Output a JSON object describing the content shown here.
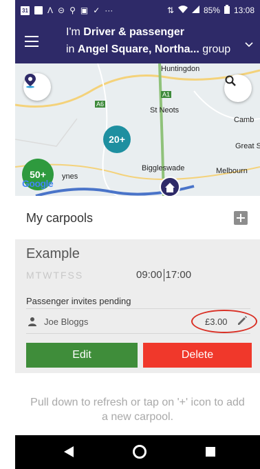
{
  "status_bar": {
    "calendar_day": "31",
    "left_icons": [
      "calendar-icon",
      "square-icon",
      "up-arrow-icon",
      "minus-circle-icon",
      "bulb-icon",
      "image-icon",
      "check-icon",
      "more-icon"
    ],
    "right_icons": [
      "transfer-icon",
      "wifi-icon",
      "signal-icon",
      "battery-icon"
    ],
    "battery": "85%",
    "time": "13:08"
  },
  "app_bar": {
    "role_prefix": "I'm ",
    "role": "Driver & passenger",
    "group_prefix": "in ",
    "group": "Angel Square, Northa...",
    "group_suffix": " group",
    "bg_color": "#2e2a68"
  },
  "map": {
    "places": {
      "huntingdon": "Huntingdon",
      "st_neots": "St Neots",
      "cambridge": "Camb",
      "great_s": "Great S",
      "biggleswade": "Biggleswade",
      "melbourn": "Melbourn",
      "milton_keynes": "ynes"
    },
    "roads": {
      "a1": "A1",
      "a6": "A6"
    },
    "clusters": [
      {
        "label": "20+",
        "color": "#1e8fa0"
      },
      {
        "label": "50+",
        "color": "#2e9a3e"
      }
    ],
    "attribution": "Google",
    "icons": [
      "location-pin-icon",
      "search-icon",
      "home-pin-icon"
    ]
  },
  "carpools": {
    "title": "My carpools",
    "add_icon": "plus-icon",
    "card": {
      "name": "Example",
      "days": "MTWTFSS",
      "depart": "09:00",
      "return": "17:00",
      "status": "Passenger invites pending",
      "passenger": "Joe Bloggs",
      "price": "£3.00",
      "edit_label": "Edit",
      "delete_label": "Delete",
      "edit_color": "#3f8d3a",
      "delete_color": "#f0382b",
      "highlight_color": "#d93025"
    }
  },
  "hint": "Pull down to refresh or tap on '+' icon to add a new carpool.",
  "nav_bar": {
    "icons": [
      "back-icon",
      "home-icon",
      "recents-icon"
    ]
  }
}
